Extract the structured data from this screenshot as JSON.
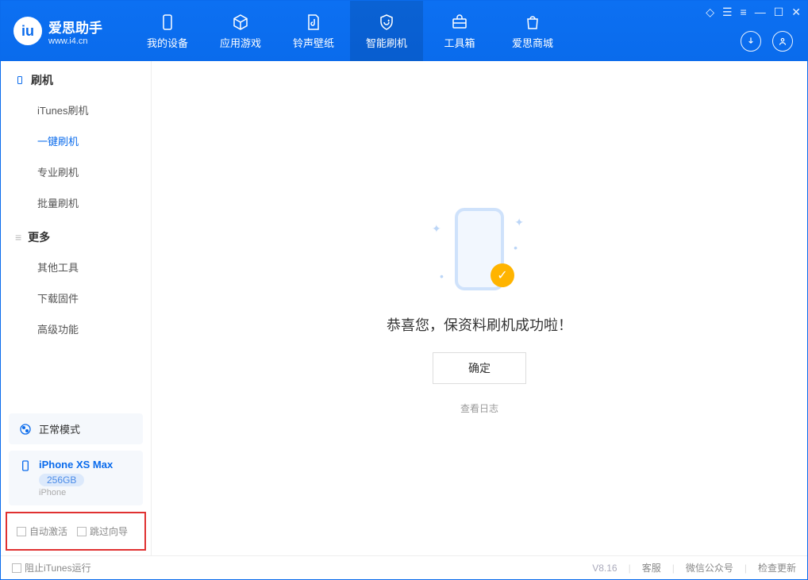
{
  "header": {
    "logo_title": "爱思助手",
    "logo_sub": "www.i4.cn",
    "tabs": [
      {
        "label": "我的设备"
      },
      {
        "label": "应用游戏"
      },
      {
        "label": "铃声壁纸"
      },
      {
        "label": "智能刷机"
      },
      {
        "label": "工具箱"
      },
      {
        "label": "爱思商城"
      }
    ]
  },
  "sidebar": {
    "group1": {
      "title": "刷机",
      "items": [
        {
          "label": "iTunes刷机"
        },
        {
          "label": "一键刷机"
        },
        {
          "label": "专业刷机"
        },
        {
          "label": "批量刷机"
        }
      ]
    },
    "group2": {
      "title": "更多",
      "items": [
        {
          "label": "其他工具"
        },
        {
          "label": "下载固件"
        },
        {
          "label": "高级功能"
        }
      ]
    },
    "mode_card": "正常模式",
    "device": {
      "name": "iPhone XS Max",
      "storage": "256GB",
      "type": "iPhone"
    },
    "checkbox1": "自动激活",
    "checkbox2": "跳过向导"
  },
  "main": {
    "success": "恭喜您，保资料刷机成功啦！",
    "ok": "确定",
    "view_log": "查看日志"
  },
  "footer": {
    "block_itunes": "阻止iTunes运行",
    "version": "V8.16",
    "customer_service": "客服",
    "wechat": "微信公众号",
    "check_update": "检查更新"
  }
}
